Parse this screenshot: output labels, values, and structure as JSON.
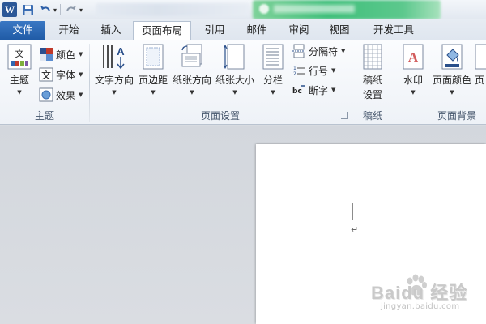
{
  "app": {
    "logo": "W"
  },
  "quick_access": [
    "save-icon",
    "undo-icon",
    "redo-icon",
    "customize-icon"
  ],
  "tabs": [
    {
      "label": "文件",
      "active": false
    },
    {
      "label": "开始",
      "active": false
    },
    {
      "label": "插入",
      "active": false
    },
    {
      "label": "页面布局",
      "active": true
    },
    {
      "label": "引用",
      "active": false
    },
    {
      "label": "邮件",
      "active": false
    },
    {
      "label": "审阅",
      "active": false
    },
    {
      "label": "视图",
      "active": false
    },
    {
      "label": "开发工具",
      "active": false
    }
  ],
  "ribbon": {
    "themes": {
      "group_label": "主题",
      "theme_button": "主题",
      "colors": "颜色",
      "fonts": "字体",
      "effects": "效果"
    },
    "page_setup": {
      "group_label": "页面设置",
      "text_direction": "文字方向",
      "margins": "页边距",
      "orientation": "纸张方向",
      "size": "纸张大小",
      "columns": "分栏",
      "breaks": "分隔符",
      "line_numbers": "行号",
      "hyphenation": "断字"
    },
    "manuscript": {
      "group_label": "稿纸",
      "button_line1": "稿纸",
      "button_line2": "设置"
    },
    "page_background": {
      "group_label": "页面背景",
      "watermark": "水印",
      "page_color": "页面颜色",
      "page_borders": "页"
    }
  },
  "document": {
    "paragraph_mark": "↵"
  },
  "watermark": {
    "brand": "Baidu 经验",
    "url": "jingyan.baidu.com"
  },
  "colors": {
    "file_tab": "#2b62ad",
    "accent": "#2b5797",
    "page": "#ffffff",
    "workspace": "#d7dbe0"
  }
}
